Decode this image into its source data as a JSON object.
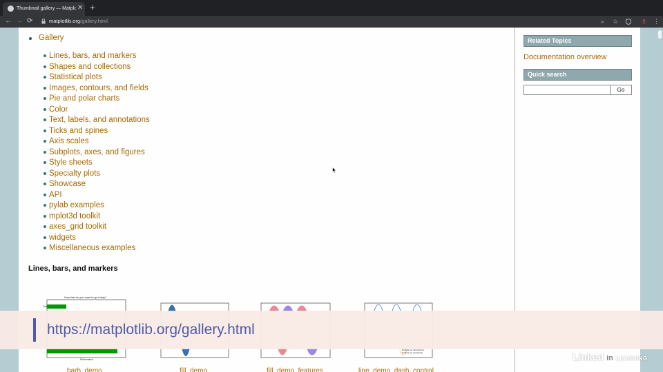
{
  "browser": {
    "tab_title": "Thumbnail gallery — Matplotli",
    "tab_close": "✕",
    "new_tab": "+",
    "url_domain": "matplotlib.org",
    "url_path": "/gallery.html",
    "back_icon": "←",
    "forward_icon": "→",
    "reload_icon": "⟳",
    "zoom_icon": "⌕",
    "star_icon": "☆",
    "menu_icon": "⋮"
  },
  "gallery": {
    "title": "Gallery",
    "items": [
      "Lines, bars, and markers",
      "Shapes and collections",
      "Statistical plots",
      "Images, contours, and fields",
      "Pie and polar charts",
      "Color",
      "Text, labels, and annotations",
      "Ticks and spines",
      "Axis scales",
      "Subplots, axes, and figures",
      "Style sheets",
      "Specialty plots",
      "Showcase",
      "API",
      "pylab examples",
      "mplot3d toolkit",
      "axes_grid toolkit",
      "widgets",
      "Miscellaneous examples"
    ],
    "section_heading": "Lines, bars, and markers",
    "thumbnails": [
      {
        "label": "barh_demo",
        "chart_title": "How fast do you want to go today?",
        "tick_label": "Tom",
        "xlabel": "Performance"
      },
      {
        "label": "fill_demo"
      },
      {
        "label": "fill_demo_features"
      },
      {
        "label": "line_demo_dash_control",
        "legend_1": "Dashes set retroactively",
        "legend_2": "Dashes set proactively"
      }
    ]
  },
  "sidebar": {
    "related_topics": "Related Topics",
    "documentation_overview": "Documentation overview",
    "quick_search": "Quick search",
    "go_label": "Go"
  },
  "overlay": {
    "url_text": "https://matplotlib.org/gallery.html"
  },
  "watermark": {
    "linked": "Linked",
    "in": "in",
    "learning": "LEARNING"
  },
  "colors": {
    "link": "#a66a00",
    "sidebar_header": "#8fa8ad",
    "banner_accent": "#4e5bab",
    "margin": "#b5cdd2"
  }
}
